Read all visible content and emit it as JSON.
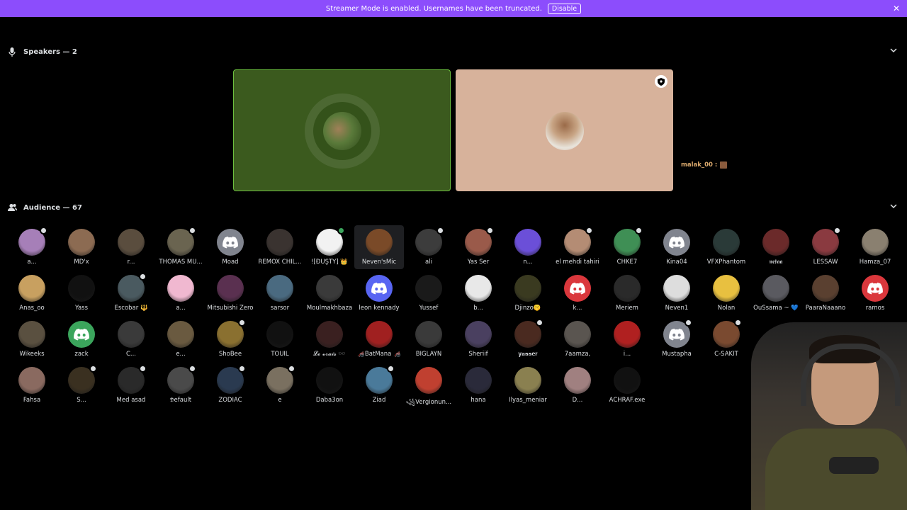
{
  "banner": {
    "message": "Streamer Mode is enabled. Usernames have been truncated.",
    "disable_label": "Disable",
    "close_icon": "close-icon",
    "color": "#8c4dfc"
  },
  "speakers": {
    "title": "Speakers — 2",
    "icon": "microphone-icon",
    "caption": "malak_00 :"
  },
  "audience": {
    "title": "Audience — 67",
    "icon": "people-icon",
    "members": [
      {
        "name": "a...",
        "color": "#a67fb8",
        "badge": "gray"
      },
      {
        "name": "MD'x",
        "color": "#8c6b52",
        "badge": ""
      },
      {
        "name": "r...",
        "color": "#5a4d3e",
        "badge": ""
      },
      {
        "name": "THOMAS MÜ...",
        "color": "#6a6450",
        "badge": "gray"
      },
      {
        "name": "Moad",
        "color": "#5865f2",
        "badge": "",
        "discord": true,
        "discordColor": "#80848e"
      },
      {
        "name": "REMOX CHIL...",
        "color": "#3a3330",
        "badge": ""
      },
      {
        "name": "![ĐÜŞŤŸ] 👑",
        "color": "#f2f2f2",
        "badge": "green"
      },
      {
        "name": "Neven'sMic",
        "color": "#7a4a28",
        "badge": "",
        "highlight": true
      },
      {
        "name": "ali",
        "color": "#3c3c3c",
        "badge": "gray"
      },
      {
        "name": "Yas Ser",
        "color": "#9a5a4a",
        "badge": "gray"
      },
      {
        "name": "n...",
        "color": "#6b4fd8",
        "badge": ""
      },
      {
        "name": "el mehdi tahiri",
        "color": "#b48c74",
        "badge": "gray"
      },
      {
        "name": "CHKE7",
        "color": "#3f8f55",
        "badge": "gray"
      },
      {
        "name": "Kina04",
        "color": "#80848e",
        "badge": "",
        "discord": true,
        "discordColor": "#80848e"
      },
      {
        "name": "VFXPhantom",
        "color": "#2a3a38",
        "badge": ""
      },
      {
        "name": "𝖓𝖊𝖋𝖆𝖆",
        "color": "#6b2a2a",
        "badge": ""
      },
      {
        "name": "LESSAW",
        "color": "#8a3a40",
        "badge": "gray"
      },
      {
        "name": "Hamza_07",
        "color": "#8a8070",
        "badge": ""
      },
      {
        "name": "Anas_oo",
        "color": "#c8a060",
        "badge": ""
      },
      {
        "name": "Yass",
        "color": "#111111",
        "badge": ""
      },
      {
        "name": "Escobar 🔱",
        "color": "#4a5a60",
        "badge": "gray"
      },
      {
        "name": "a...",
        "color": "#f0b8d0",
        "badge": ""
      },
      {
        "name": "Mitsubishi Zero",
        "color": "#5a3050",
        "badge": ""
      },
      {
        "name": "sarsor",
        "color": "#4a6a80",
        "badge": ""
      },
      {
        "name": "Moulmakhbaza",
        "color": "#3a3a3a",
        "badge": ""
      },
      {
        "name": "leon kennady",
        "color": "#5865f2",
        "badge": "",
        "discord": true,
        "discordColor": "#5865f2"
      },
      {
        "name": "Yussef",
        "color": "#1a1a1a",
        "badge": ""
      },
      {
        "name": "b...",
        "color": "#e8e8e8",
        "badge": ""
      },
      {
        "name": "Djinzo🤫",
        "color": "#3a3a20",
        "badge": ""
      },
      {
        "name": "k...",
        "color": "#da373c",
        "badge": "",
        "discord": true,
        "discordColor": "#da373c"
      },
      {
        "name": "Meriem",
        "color": "#2a2a2a",
        "badge": ""
      },
      {
        "name": "Neven1",
        "color": "#dddddd",
        "badge": ""
      },
      {
        "name": "Nolan",
        "color": "#e8c040",
        "badge": ""
      },
      {
        "name": "OuSsama ~ 💙",
        "color": "#5a5a60",
        "badge": ""
      },
      {
        "name": "PaaraNaaano",
        "color": "#5a4030",
        "badge": ""
      },
      {
        "name": "ramos",
        "color": "#da373c",
        "badge": "",
        "discord": true,
        "discordColor": "#da373c"
      },
      {
        "name": "Wikeeks",
        "color": "#5a5040",
        "badge": ""
      },
      {
        "name": "zack",
        "color": "#3ba55c",
        "badge": "",
        "discord": true,
        "discordColor": "#3ba55c"
      },
      {
        "name": "C...",
        "color": "#3a3a3a",
        "badge": ""
      },
      {
        "name": "e...",
        "color": "#6a5a40",
        "badge": ""
      },
      {
        "name": "ShoBee",
        "color": "#8a7030",
        "badge": "gray"
      },
      {
        "name": "TOUIL",
        "color": "#111111",
        "badge": ""
      },
      {
        "name": "𝓛𝓮 𝓿𝓻𝓪𝓲𝓼 🕶️",
        "color": "#3a2020",
        "badge": ""
      },
      {
        "name": "🦽BatMana 🦽",
        "color": "#a02020",
        "badge": ""
      },
      {
        "name": "BIGLAYN",
        "color": "#3a3a3a",
        "badge": ""
      },
      {
        "name": "Sheriif",
        "color": "#4a4060",
        "badge": ""
      },
      {
        "name": "𝐲𝐚𝐬𝐬𝐞𝐫",
        "color": "#4a2a20",
        "badge": "gray"
      },
      {
        "name": "7aamza,",
        "color": "#5a5550",
        "badge": ""
      },
      {
        "name": "i...",
        "color": "#b02020",
        "badge": ""
      },
      {
        "name": "Mustapha",
        "color": "#80848e",
        "badge": "gray",
        "discord": true,
        "discordColor": "#80848e"
      },
      {
        "name": "C-SAKIT",
        "color": "#7a4a30",
        "badge": "gray"
      },
      {
        "name": "Fahsa",
        "color": "#8a6a60",
        "badge": ""
      },
      {
        "name": "S...",
        "color": "#3a3020",
        "badge": "gray"
      },
      {
        "name": "Med asad",
        "color": "#2a2a2a",
        "badge": "gray"
      },
      {
        "name": "𝕯efault",
        "color": "#4a4a4a",
        "badge": "gray"
      },
      {
        "name": "ZODIAC",
        "color": "#2a3a50",
        "badge": "gray"
      },
      {
        "name": "e",
        "color": "#7a7060",
        "badge": "gray"
      },
      {
        "name": "Daba3on",
        "color": "#111111",
        "badge": ""
      },
      {
        "name": "Ziad",
        "color": "#4a7a9a",
        "badge": "gray"
      },
      {
        "name": "꧁Vergionun...",
        "color": "#c04030",
        "badge": ""
      },
      {
        "name": "hana",
        "color": "#2a2a3a",
        "badge": ""
      },
      {
        "name": "Ilyas_meniar",
        "color": "#8a8050",
        "badge": ""
      },
      {
        "name": "D...",
        "color": "#a08080",
        "badge": ""
      },
      {
        "name": "ACHRAF.exe",
        "color": "#111111",
        "badge": ""
      }
    ]
  }
}
